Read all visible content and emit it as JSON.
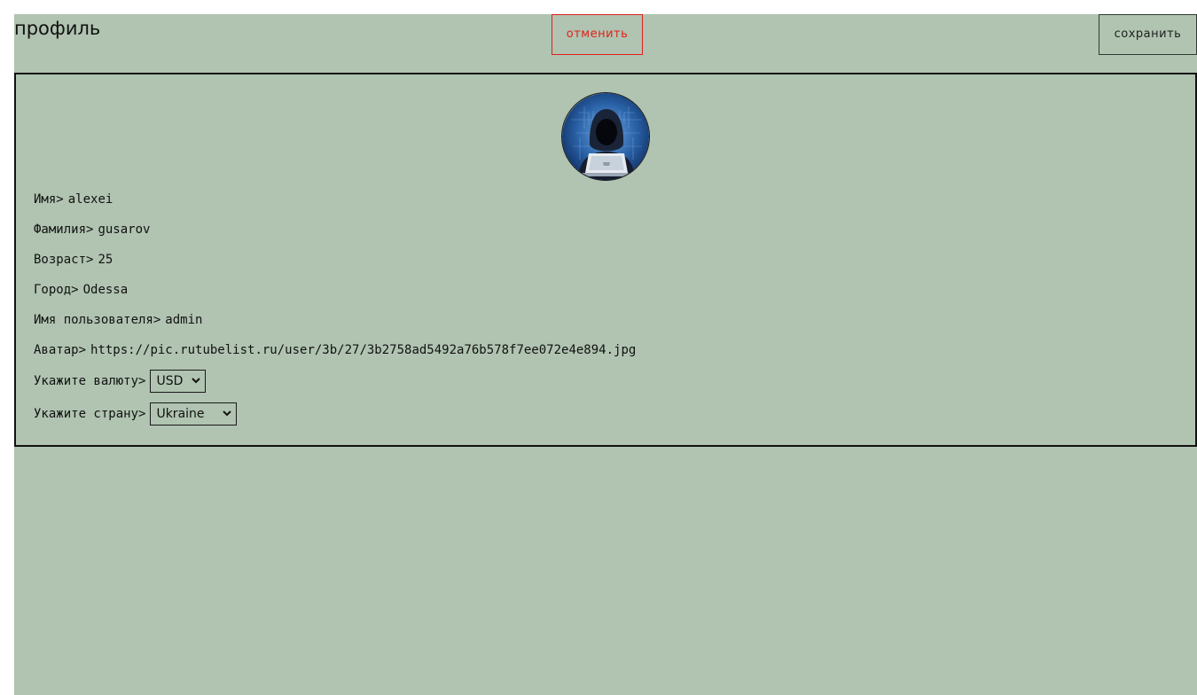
{
  "header": {
    "title": "профиль",
    "cancel_label": "отменить",
    "save_label": "сохранить"
  },
  "avatar": {
    "icon": "hooded-hacker-laptop-avatar"
  },
  "fields": [
    {
      "label": "Имя",
      "separator": ">",
      "value": "alexei"
    },
    {
      "label": "Фамилия",
      "separator": ">",
      "value": "gusarov"
    },
    {
      "label": "Возраст",
      "separator": ">",
      "value": "25"
    },
    {
      "label": "Город",
      "separator": ">",
      "value": "Odessa"
    },
    {
      "label": "Имя пользователя",
      "separator": ">",
      "value": "admin"
    },
    {
      "label": "Аватар",
      "separator": ">",
      "value": "https://pic.rutubelist.ru/user/3b/27/3b2758ad5492a76b578f7ee072e4e894.jpg"
    }
  ],
  "currency": {
    "label": "Укажите валюту",
    "separator": ">",
    "selected": "USD"
  },
  "country": {
    "label": "Укажите страну",
    "separator": ">",
    "selected": "Ukraine"
  },
  "colors": {
    "background": "#b0c4b1",
    "cancel": "#e0201a",
    "border": "#111111"
  }
}
